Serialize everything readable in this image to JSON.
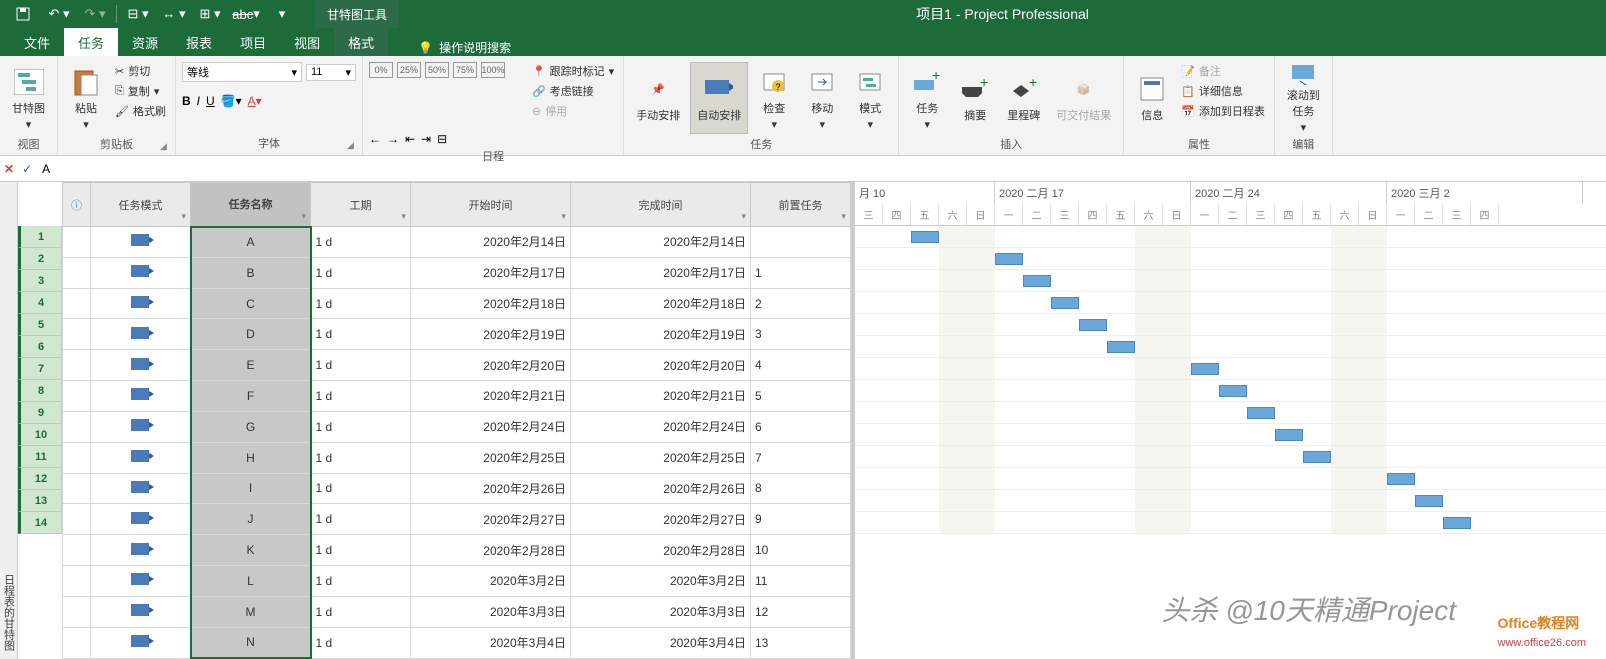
{
  "app": {
    "title": "项目1 - Project Professional",
    "contextual_tab": "甘特图工具"
  },
  "qat": [
    "save",
    "undo",
    "redo",
    "link",
    "outdent",
    "indent",
    "strikethrough"
  ],
  "tabs": {
    "file": "文件",
    "task": "任务",
    "resource": "资源",
    "report": "报表",
    "project": "项目",
    "view": "视图",
    "format": "格式",
    "tellme": "操作说明搜索"
  },
  "ribbon": {
    "view": {
      "gantt": "甘特图",
      "label": "视图"
    },
    "clipboard": {
      "paste": "粘贴",
      "cut": "剪切",
      "copy": "复制",
      "format_painter": "格式刷",
      "label": "剪贴板"
    },
    "font": {
      "name": "等线",
      "size": "11",
      "label": "字体"
    },
    "schedule": {
      "pct_labels": [
        "0%",
        "25%",
        "50%",
        "75%",
        "100%"
      ],
      "mark_on_track": "跟踪时标记",
      "respect_links": "考虑链接",
      "inactivate": "停用",
      "label": "日程"
    },
    "tasks": {
      "manual": "手动安排",
      "auto": "自动安排",
      "inspect": "检查",
      "move": "移动",
      "mode": "模式",
      "label": "任务"
    },
    "insert": {
      "task": "任务",
      "summary": "摘要",
      "milestone": "里程碑",
      "deliverable": "可交付结果",
      "label": "插入"
    },
    "properties": {
      "information": "信息",
      "notes": "备注",
      "details": "详细信息",
      "add_to_timeline": "添加到日程表",
      "label": "属性"
    },
    "editing": {
      "scroll_to_task": "滚动到\n任务",
      "label": "编辑"
    }
  },
  "entry": {
    "value": "A"
  },
  "columns": {
    "info": "",
    "mode": "任务模式",
    "name": "任务名称",
    "duration": "工期",
    "start": "开始时间",
    "finish": "完成时间",
    "predecessors": "前置任务"
  },
  "rows": [
    {
      "id": 1,
      "name": "A",
      "dur": "1 d",
      "start": "2020年2月14日",
      "finish": "2020年2月14日",
      "pred": "",
      "day": 4
    },
    {
      "id": 2,
      "name": "B",
      "dur": "1 d",
      "start": "2020年2月17日",
      "finish": "2020年2月17日",
      "pred": "1",
      "day": 7
    },
    {
      "id": 3,
      "name": "C",
      "dur": "1 d",
      "start": "2020年2月18日",
      "finish": "2020年2月18日",
      "pred": "2",
      "day": 8
    },
    {
      "id": 4,
      "name": "D",
      "dur": "1 d",
      "start": "2020年2月19日",
      "finish": "2020年2月19日",
      "pred": "3",
      "day": 9
    },
    {
      "id": 5,
      "name": "E",
      "dur": "1 d",
      "start": "2020年2月20日",
      "finish": "2020年2月20日",
      "pred": "4",
      "day": 10
    },
    {
      "id": 6,
      "name": "F",
      "dur": "1 d",
      "start": "2020年2月21日",
      "finish": "2020年2月21日",
      "pred": "5",
      "day": 11
    },
    {
      "id": 7,
      "name": "G",
      "dur": "1 d",
      "start": "2020年2月24日",
      "finish": "2020年2月24日",
      "pred": "6",
      "day": 14
    },
    {
      "id": 8,
      "name": "H",
      "dur": "1 d",
      "start": "2020年2月25日",
      "finish": "2020年2月25日",
      "pred": "7",
      "day": 15
    },
    {
      "id": 9,
      "name": "I",
      "dur": "1 d",
      "start": "2020年2月26日",
      "finish": "2020年2月26日",
      "pred": "8",
      "day": 16
    },
    {
      "id": 10,
      "name": "J",
      "dur": "1 d",
      "start": "2020年2月27日",
      "finish": "2020年2月27日",
      "pred": "9",
      "day": 17
    },
    {
      "id": 11,
      "name": "K",
      "dur": "1 d",
      "start": "2020年2月28日",
      "finish": "2020年2月28日",
      "pred": "10",
      "day": 18
    },
    {
      "id": 12,
      "name": "L",
      "dur": "1 d",
      "start": "2020年3月2日",
      "finish": "2020年3月2日",
      "pred": "11",
      "day": 21
    },
    {
      "id": 13,
      "name": "M",
      "dur": "1 d",
      "start": "2020年3月3日",
      "finish": "2020年3月3日",
      "pred": "12",
      "day": 22
    },
    {
      "id": 14,
      "name": "N",
      "dur": "1 d",
      "start": "2020年3月4日",
      "finish": "2020年3月4日",
      "pred": "13",
      "day": 23
    }
  ],
  "gantt": {
    "major": [
      "月 10",
      "2020 二月 17",
      "2020 二月 24",
      "2020 三月 2"
    ],
    "minor": [
      "三",
      "四",
      "五",
      "六",
      "日",
      "一",
      "二",
      "三",
      "四",
      "五",
      "六",
      "日",
      "一",
      "二",
      "三",
      "四",
      "五",
      "六",
      "日",
      "一",
      "二",
      "三",
      "四"
    ],
    "weekends": [
      3,
      4,
      10,
      11,
      17,
      18
    ],
    "day_width": 28
  },
  "side_label": "日程表的甘特图",
  "watermark1": "头杀 @10天精通Project",
  "watermark2a": "Office教程网",
  "watermark2b": "www.office26.com"
}
